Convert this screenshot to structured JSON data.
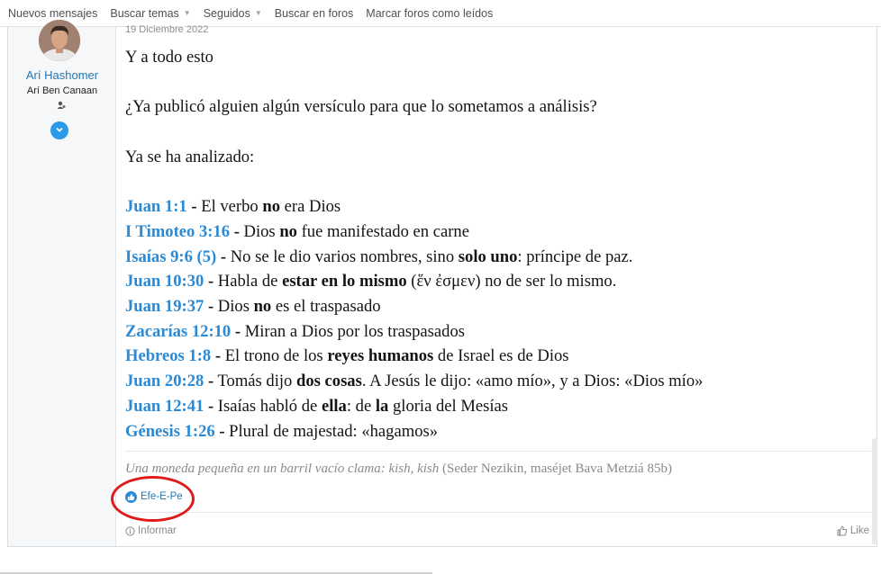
{
  "nav": {
    "items": [
      {
        "label": "Nuevos mensajes",
        "dropdown": false
      },
      {
        "label": "Buscar temas",
        "dropdown": true
      },
      {
        "label": "Seguidos",
        "dropdown": true
      },
      {
        "label": "Buscar en foros",
        "dropdown": false
      },
      {
        "label": "Marcar foros como leídos",
        "dropdown": false
      }
    ]
  },
  "user": {
    "name": "Arí Hashomer",
    "title": "Arí Ben Canaan",
    "badge_icon": "user-group-icon",
    "expand_icon": "chevron-down-icon"
  },
  "post": {
    "date": "19 Diciembre 2022",
    "intro1": "Y a todo esto",
    "intro2": "¿Ya publicó alguien algún versículo para que lo sometamos a análisis?",
    "intro3": "Ya se ha analizado:",
    "verses": [
      {
        "ref": "Juan 1:1",
        "t1": " El verbo ",
        "b1": "no",
        "t2": " era Dios",
        "b2": "",
        "t3": "",
        "b3": "",
        "t4": ""
      },
      {
        "ref": "I Timoteo 3:16",
        "t1": " Dios ",
        "b1": "no",
        "t2": " fue manifestado en carne",
        "b2": "",
        "t3": "",
        "b3": "",
        "t4": ""
      },
      {
        "ref": "Isaías 9:6 (5)",
        "t1": " No se le dio varios nombres, sino ",
        "b1": "solo uno",
        "t2": ": príncipe de paz.",
        "b2": "",
        "t3": "",
        "b3": "",
        "t4": ""
      },
      {
        "ref": "Juan 10:30",
        "t1": " Habla de ",
        "b1": "estar en lo mismo",
        "t2": " (ἕν ἐσμεν) no de ser lo mismo.",
        "b2": "",
        "t3": "",
        "b3": "",
        "t4": ""
      },
      {
        "ref": "Juan 19:37",
        "t1": " Dios ",
        "b1": "no",
        "t2": " es el traspasado",
        "b2": "",
        "t3": "",
        "b3": "",
        "t4": ""
      },
      {
        "ref": "Zacarías 12:10",
        "t1": " Miran a Dios por los traspasados",
        "b1": "",
        "t2": "",
        "b2": "",
        "t3": "",
        "b3": "",
        "t4": ""
      },
      {
        "ref": "Hebreos 1:8",
        "t1": " El trono de los ",
        "b1": "reyes humanos",
        "t2": " de Israel es de Dios",
        "b2": "",
        "t3": "",
        "b3": "",
        "t4": ""
      },
      {
        "ref": "Juan 20:28",
        "t1": " Tomás dijo ",
        "b1": "dos cosas",
        "t2": ". A Jesús le dijo: «amo mío», y a Dios: «Dios mío»",
        "b2": "",
        "t3": "",
        "b3": "",
        "t4": ""
      },
      {
        "ref": "Juan 12:41",
        "t1": " Isaías habló de ",
        "b1": "ella",
        "t2": ": de ",
        "b2": "la",
        "t3": " gloria del Mesías",
        "b3": "",
        "t4": ""
      },
      {
        "ref": "Génesis 1:26",
        "t1": " Plural de majestad: «hagamos»",
        "b1": "",
        "t2": "",
        "b2": "",
        "t3": "",
        "b3": "",
        "t4": ""
      }
    ],
    "dash": " -"
  },
  "signature": {
    "italic": "Una moneda pequeña en un barril vacío clama: kish, kish",
    "plain": " (Seder Nezikin, maséjet Bava Metziá 85b)"
  },
  "reactions": {
    "icon": "thumbs-up-icon",
    "users": "Efe-E-Pe"
  },
  "actions": {
    "report_label": "Informar",
    "report_icon": "info-circle-icon",
    "like_label": "Like",
    "like_icon": "thumbs-up-outline-icon"
  },
  "colors": {
    "link": "#2a8ad6",
    "username": "#2577b1",
    "annotation": "#e01b1b"
  }
}
